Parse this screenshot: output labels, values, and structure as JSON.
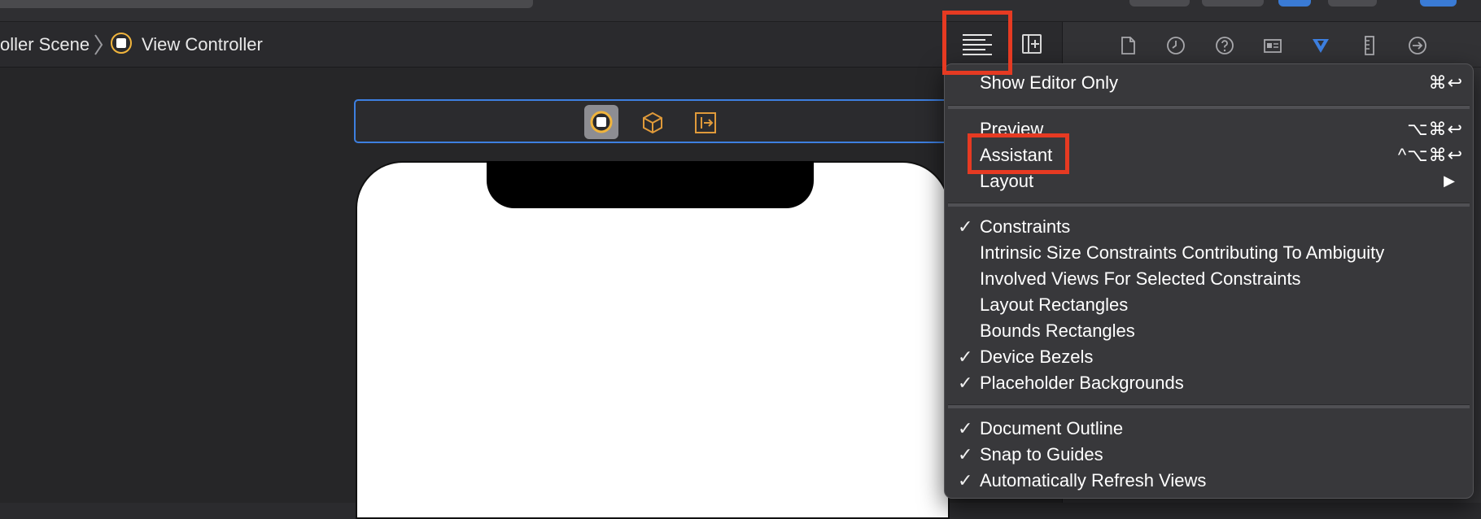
{
  "breadcrumb": {
    "scene_label": "oller Scene",
    "controller_label": "View Controller"
  },
  "icons": {
    "editor_options": "editor-options-icon",
    "add_editor": "add-editor-icon",
    "inspectors": [
      "file-icon",
      "history-icon",
      "help-icon",
      "identity-icon",
      "attributes-icon",
      "size-icon",
      "connections-icon"
    ],
    "scene_dock": [
      "view-controller-icon",
      "first-responder-icon",
      "exit-icon"
    ]
  },
  "menu": {
    "show_editor_only": {
      "label": "Show Editor Only",
      "shortcut": "⌘↩"
    },
    "preview": {
      "label": "Preview",
      "shortcut": "⌥⌘↩"
    },
    "assistant": {
      "label": "Assistant",
      "shortcut": "^⌥⌘↩"
    },
    "layout": {
      "label": "Layout",
      "arrow": "▶"
    },
    "check_mark": "✓",
    "options": [
      {
        "label": "Constraints",
        "checked": true
      },
      {
        "label": "Intrinsic Size Constraints Contributing To Ambiguity",
        "checked": false
      },
      {
        "label": "Involved Views For Selected Constraints",
        "checked": false
      },
      {
        "label": "Layout Rectangles",
        "checked": false
      },
      {
        "label": "Bounds Rectangles",
        "checked": false
      },
      {
        "label": "Device Bezels",
        "checked": true
      },
      {
        "label": "Placeholder Backgrounds",
        "checked": true
      }
    ],
    "outline_options": [
      {
        "label": "Document Outline",
        "checked": true
      },
      {
        "label": "Snap to Guides",
        "checked": true
      },
      {
        "label": "Automatically Refresh Views",
        "checked": true
      }
    ]
  },
  "colors": {
    "highlight": "#e63a22",
    "accent": "#3d7fe0",
    "scene_icon": "#f0b43c"
  }
}
